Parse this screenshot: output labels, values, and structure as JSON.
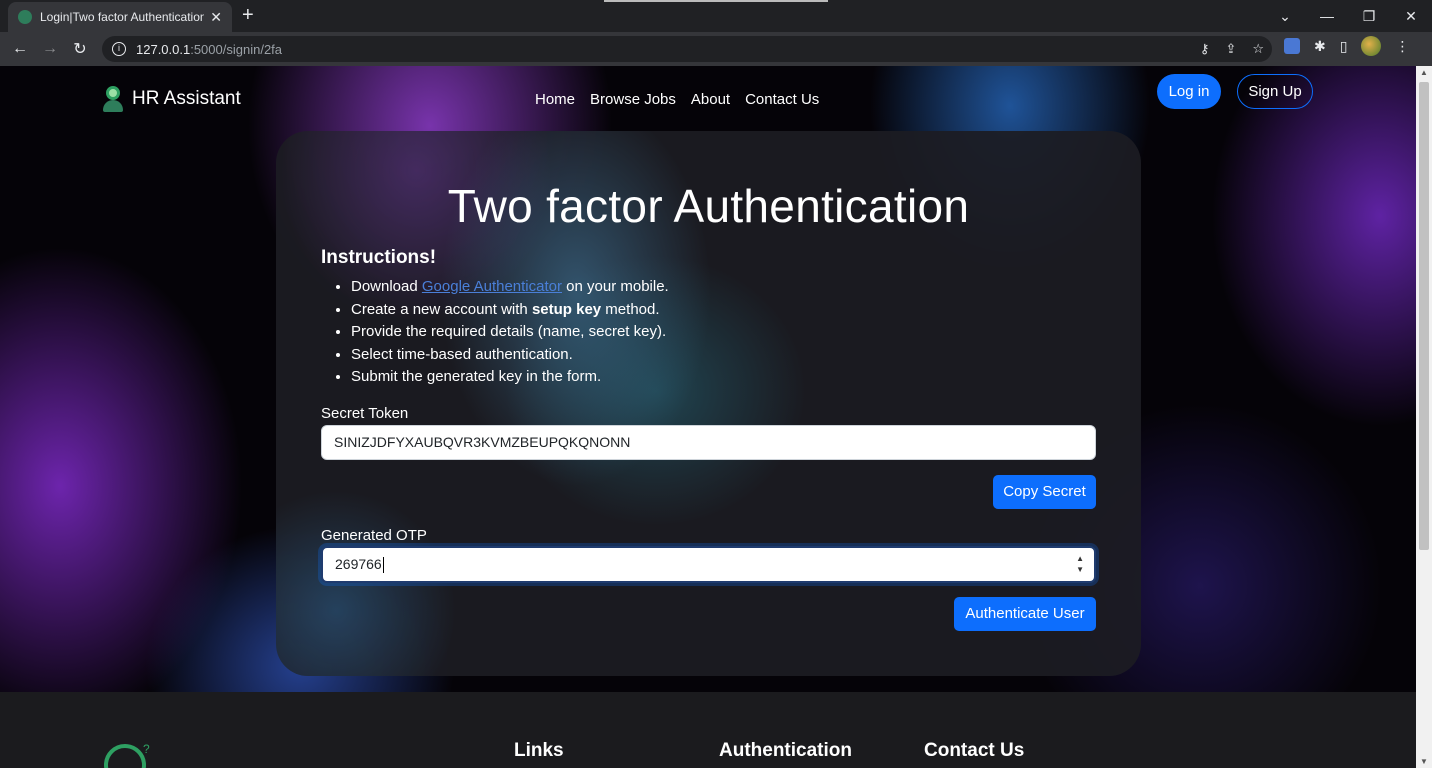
{
  "browser": {
    "tab_title": "Login|Two factor Authentication",
    "url_host": "127.0.0.1",
    "url_path": ":5000/signin/2fa"
  },
  "navbar": {
    "brand": "HR Assistant",
    "links": [
      "Home",
      "Browse Jobs",
      "About",
      "Contact Us"
    ],
    "login_label": "Log in",
    "signup_label": "Sign Up"
  },
  "card": {
    "title": "Two factor Authentication",
    "instructions_title": "Instructions!",
    "instructions": {
      "i1_pre": "Download ",
      "i1_link": "Google Authenticator",
      "i1_post": " on your mobile.",
      "i2_pre": "Create a new account with ",
      "i2_bold": "setup key",
      "i2_post": " method.",
      "i3": "Provide the required details (name, secret key).",
      "i4": "Select time-based authentication.",
      "i5": "Submit the generated key in the form."
    },
    "secret_label": "Secret Token",
    "secret_value": "SINIZJDFYXAUBQVR3KVMZBEUPQKQNONN",
    "copy_label": "Copy Secret",
    "otp_label": "Generated OTP",
    "otp_value": "269766",
    "auth_label": "Authenticate User"
  },
  "footer": {
    "col_links": "Links",
    "col_auth": "Authentication",
    "col_contact": "Contact Us"
  },
  "colors": {
    "primary": "#0d6efd",
    "brand_green": "#2ea062"
  }
}
